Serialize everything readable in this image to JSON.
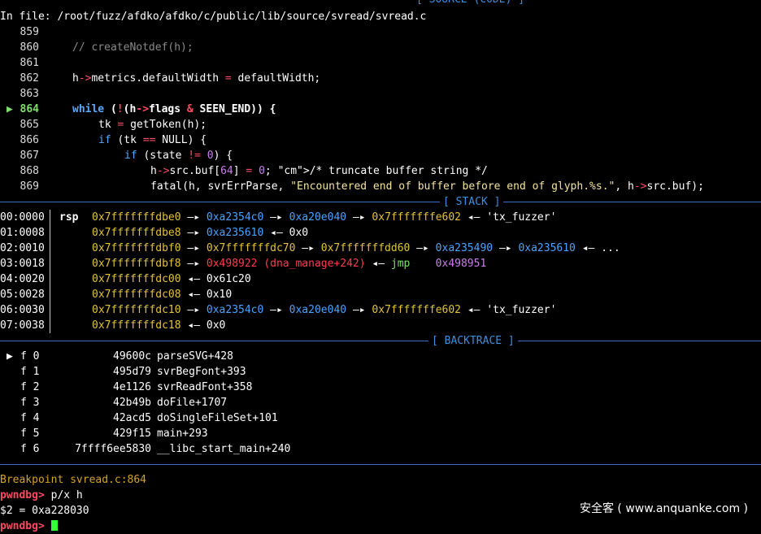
{
  "source": {
    "header_title": "[ SOURCE (CODE) ]",
    "file_line": "In file: /root/fuzz/afdko/afdko/c/public/lib/source/svread/svread.c",
    "lines": [
      {
        "n": "859",
        "t": ""
      },
      {
        "n": "860",
        "t": "// createNotdef(h);"
      },
      {
        "n": "861",
        "t": ""
      },
      {
        "n": "862",
        "t": "h->metrics.defaultWidth = defaultWidth;"
      },
      {
        "n": "863",
        "t": ""
      },
      {
        "n": "864",
        "t": "while (!(h->flags & SEEN_END)) {"
      },
      {
        "n": "865",
        "t": "tk = getToken(h);"
      },
      {
        "n": "866",
        "t": "if (tk == NULL) {"
      },
      {
        "n": "867",
        "t": "if (state != 0) {"
      },
      {
        "n": "868",
        "t": "h->src.buf[64] = 0; /* truncate buffer string */"
      },
      {
        "n": "869",
        "t": "fatal(h, svrErrParse, \"Encountered end of buffer before end of glyph.%s.\", h->src.buf);"
      }
    ],
    "current_marker": "▶"
  },
  "stack": {
    "header_title": "[ STACK ]",
    "rows": [
      {
        "idx": "00:0000",
        "reg": "rsp",
        "a": "0x7fffffffdbe0",
        "chain": [
          "0xa2354c0",
          "0xa20e040",
          "0x7fffffffe602"
        ],
        "tail": "'tx_fuzzer'"
      },
      {
        "idx": "01:0008",
        "reg": "",
        "a": "0x7fffffffdbe8",
        "chain": [
          "0xa235610"
        ],
        "tail": "0x0"
      },
      {
        "idx": "02:0010",
        "reg": "",
        "a": "0x7fffffffdbf0",
        "chain": [
          "0x7fffffffdc70",
          "0x7fffffffdd60",
          "0xa235490",
          "0xa235610"
        ],
        "tail": "..."
      },
      {
        "idx": "03:0018",
        "reg": "",
        "a": "0x7fffffffdbf8",
        "code": "0x498922 (dna_manage+242)",
        "insn": "jmp",
        "insn_arg": "0x498951"
      },
      {
        "idx": "04:0020",
        "reg": "",
        "a": "0x7fffffffdc00",
        "chain": [],
        "tail": "0x61c20"
      },
      {
        "idx": "05:0028",
        "reg": "",
        "a": "0x7fffffffdc08",
        "chain": [],
        "tail": "0x10"
      },
      {
        "idx": "06:0030",
        "reg": "",
        "a": "0x7fffffffdc10",
        "chain": [
          "0xa2354c0",
          "0xa20e040",
          "0x7fffffffe602"
        ],
        "tail": "'tx_fuzzer'"
      },
      {
        "idx": "07:0038",
        "reg": "",
        "a": "0x7fffffffdc18",
        "chain": [],
        "tail": "0x0"
      }
    ],
    "arrow": "—▸",
    "back_arrow": "◂—"
  },
  "backtrace": {
    "header_title": "[ BACKTRACE ]",
    "frames": [
      {
        "mark": "▶",
        "f": "f 0",
        "addr": "49600c",
        "sym": "parseSVG+428"
      },
      {
        "mark": "",
        "f": "f 1",
        "addr": "495d79",
        "sym": "svrBegFont+393"
      },
      {
        "mark": "",
        "f": "f 2",
        "addr": "4e1126",
        "sym": "svrReadFont+358"
      },
      {
        "mark": "",
        "f": "f 3",
        "addr": "42b49b",
        "sym": "doFile+1707"
      },
      {
        "mark": "",
        "f": "f 4",
        "addr": "42acd5",
        "sym": "doSingleFileSet+101"
      },
      {
        "mark": "",
        "f": "f 5",
        "addr": "429f15",
        "sym": "main+293"
      },
      {
        "mark": "",
        "f": "f 6",
        "addr": "7ffff6ee5830",
        "sym": "__libc_start_main+240"
      }
    ]
  },
  "console": {
    "breakpoint": "Breakpoint svread.c:864",
    "prompt": "pwndbg>",
    "command": "p/x h",
    "result": "$2 = 0xa228030",
    "prompt2": "pwndbg>"
  },
  "watermark": "安全客 ( www.anquanke.com )"
}
